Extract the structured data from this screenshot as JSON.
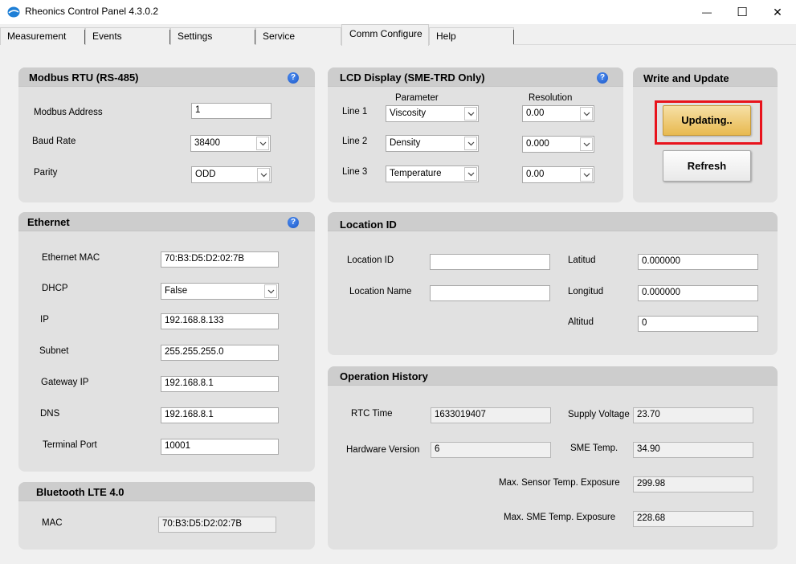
{
  "window": {
    "title": "Rheonics Control Panel 4.3.0.2",
    "minimize_glyph": "—",
    "maximize_glyph": "☐",
    "close_glyph": "✕"
  },
  "tabs": [
    {
      "label": "Measurement"
    },
    {
      "label": "Events"
    },
    {
      "label": "Settings"
    },
    {
      "label": "Service"
    },
    {
      "label": "Comm Configure",
      "active": true
    },
    {
      "label": "Help"
    }
  ],
  "modbus": {
    "title": "Modbus RTU (RS-485)",
    "address_label": "Modbus Address",
    "address_value": "1",
    "baud_label": "Baud Rate",
    "baud_value": "38400",
    "parity_label": "Parity",
    "parity_value": "ODD"
  },
  "lcd": {
    "title": "LCD Display (SME-TRD Only)",
    "parameter_header": "Parameter",
    "resolution_header": "Resolution",
    "lines": [
      {
        "label": "Line 1",
        "parameter": "Viscosity",
        "resolution": "0.00"
      },
      {
        "label": "Line 2",
        "parameter": "Density",
        "resolution": "0.000"
      },
      {
        "label": "Line 3",
        "parameter": "Temperature",
        "resolution": "0.00"
      }
    ]
  },
  "write_update": {
    "title": "Write and Update",
    "updating_label": "Updating..",
    "refresh_label": "Refresh",
    "highlight_color": "#e8131c"
  },
  "ethernet": {
    "title": "Ethernet",
    "mac_label": "Ethernet MAC",
    "mac_value": "70:B3:D5:D2:02:7B",
    "dhcp_label": "DHCP",
    "dhcp_value": "False",
    "ip_label": "IP",
    "ip_value": "192.168.8.133",
    "subnet_label": "Subnet",
    "subnet_value": "255.255.255.0",
    "gateway_label": "Gateway IP",
    "gateway_value": "192.168.8.1",
    "dns_label": "DNS",
    "dns_value": "192.168.8.1",
    "port_label": "Terminal Port",
    "port_value": "10001"
  },
  "location": {
    "title": "Location ID",
    "id_label": "Location ID",
    "id_value": "",
    "name_label": "Location Name",
    "name_value": "",
    "lat_label": "Latitud",
    "lat_value": "0.000000",
    "lon_label": "Longitud",
    "lon_value": "0.000000",
    "alt_label": "Altitud",
    "alt_value": "0"
  },
  "history": {
    "title": "Operation History",
    "rtc_label": "RTC Time",
    "rtc_value": "1633019407",
    "hw_label": "Hardware Version",
    "hw_value": "6",
    "supply_label": "Supply Voltage",
    "supply_value": "23.70",
    "sme_temp_label": "SME Temp.",
    "sme_temp_value": "34.90",
    "max_sensor_label": "Max. Sensor Temp. Exposure",
    "max_sensor_value": "299.98",
    "max_sme_label": "Max. SME Temp. Exposure",
    "max_sme_value": "228.68"
  },
  "bluetooth": {
    "title": "Bluetooth LTE 4.0",
    "mac_label": "MAC",
    "mac_value": "70:B3:D5:D2:02:7B"
  },
  "help_glyph": "?"
}
